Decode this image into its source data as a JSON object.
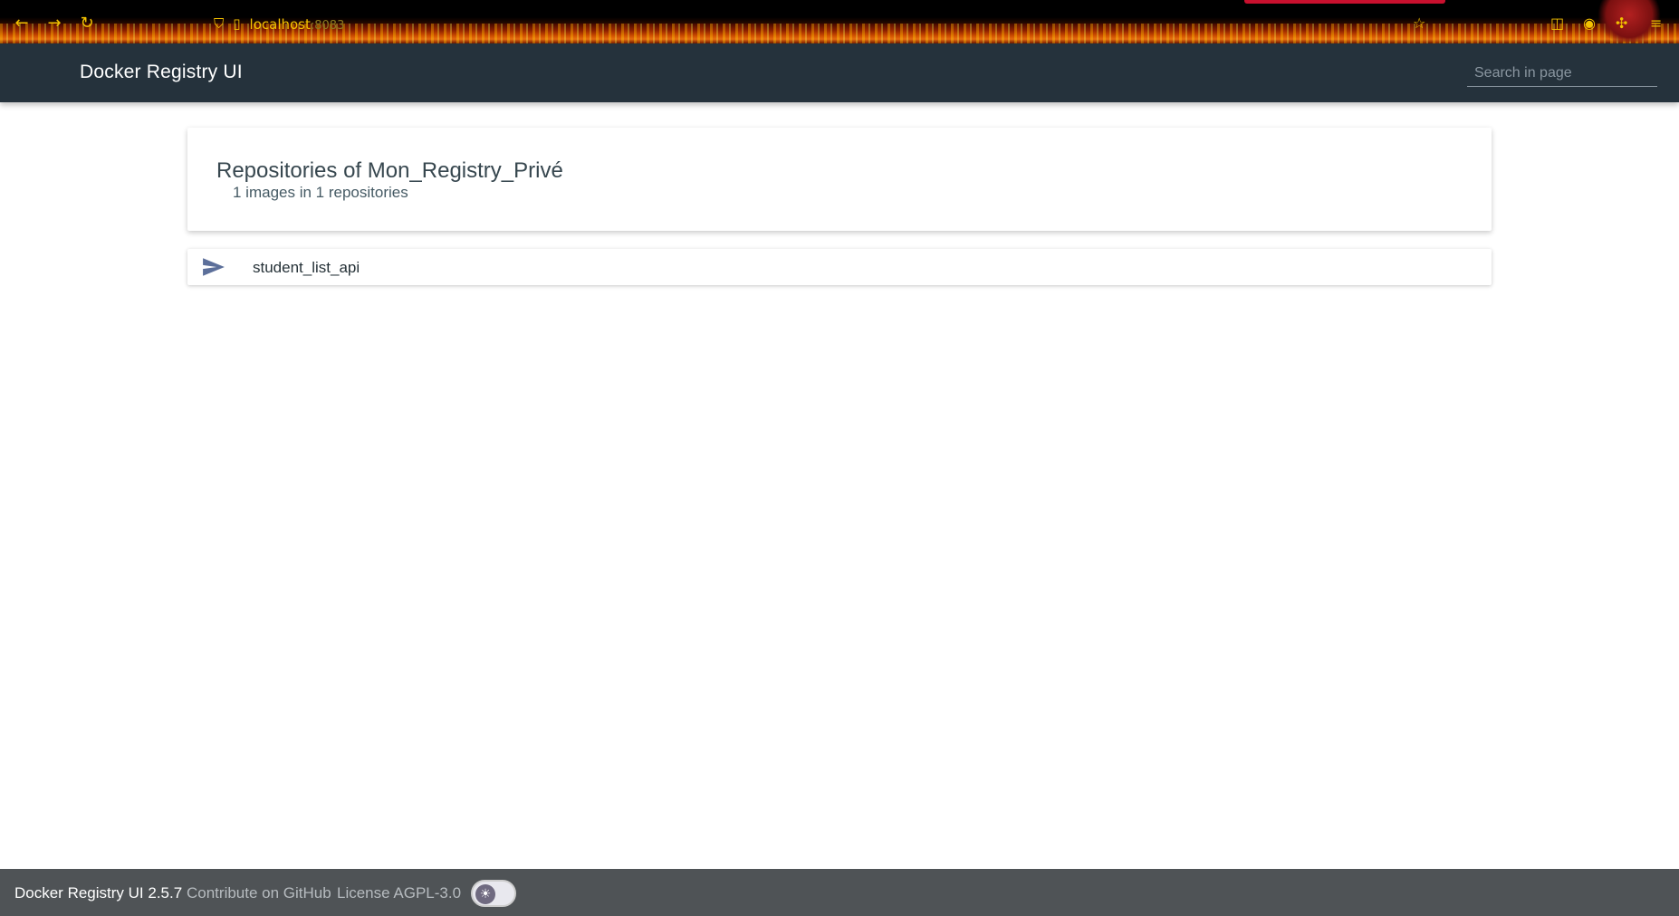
{
  "browser": {
    "host": "localhost",
    "port": ":8083",
    "icons": [
      "back-icon",
      "forward-icon",
      "reload-icon",
      "shield-icon",
      "page-icon",
      "star-icon",
      "pocket-icon",
      "account-icon",
      "extensions-icon",
      "menu-icon"
    ]
  },
  "header": {
    "title": "Docker Registry UI",
    "search_placeholder": "Search in page"
  },
  "repositories": {
    "title": "Repositories of Mon_Registry_Privé",
    "summary": "1 images in 1 repositories",
    "items": [
      {
        "name": "student_list_api",
        "icon": "send-icon"
      }
    ]
  },
  "footer": {
    "version": "Docker Registry UI 2.5.7",
    "contribute_link": "Contribute on GitHub",
    "license_link": "License AGPL-3.0",
    "theme_toggle_icon": "sun-icon"
  },
  "colors": {
    "header_bg": "#25323c",
    "footer_bg": "#4f5356",
    "accent_icon": "#5c6f9a",
    "browser_accent": "#f2c200"
  }
}
